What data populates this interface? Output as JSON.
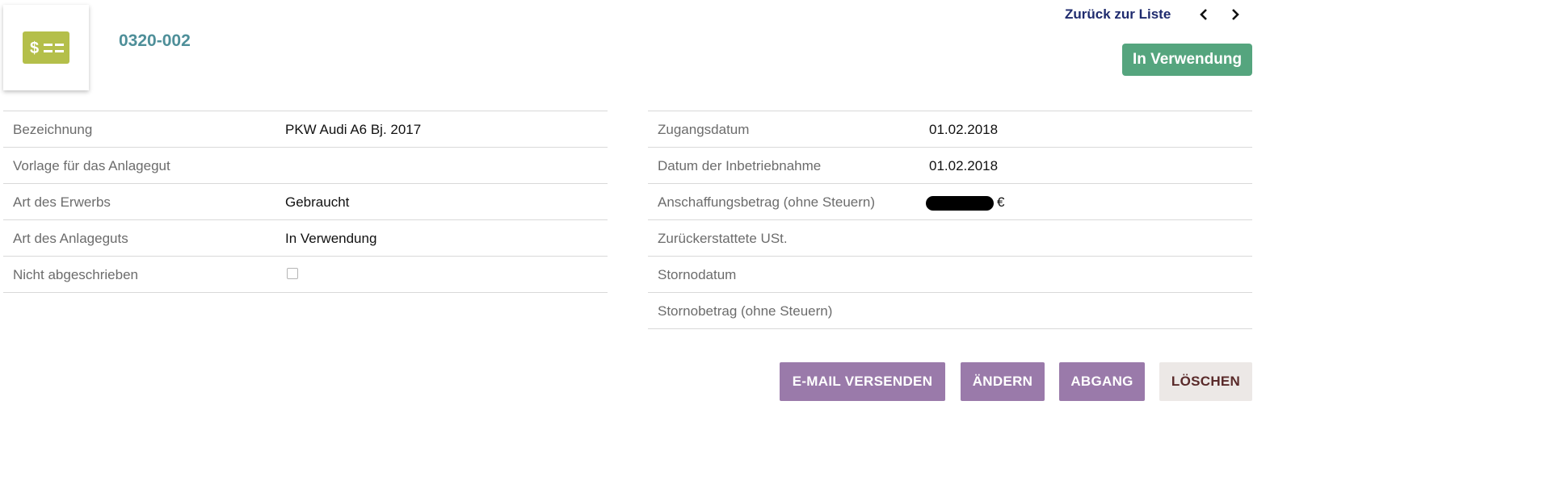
{
  "header": {
    "asset_id": "0320-002",
    "back_link": "Zurück zur Liste",
    "status": "In Verwendung",
    "logo_icon": "money-bill-icon",
    "logo_color": "#b4bf4a"
  },
  "left_table": [
    {
      "label": "Bezeichnung",
      "value": "PKW Audi A6 Bj. 2017"
    },
    {
      "label": "Vorlage für das Anlagegut",
      "value": ""
    },
    {
      "label": "Art des Erwerbs",
      "value": "Gebraucht"
    },
    {
      "label": "Art des Anlageguts",
      "value": "In Verwendung"
    },
    {
      "label": "Nicht abgeschrieben",
      "value": ""
    }
  ],
  "right_table": [
    {
      "label": "Zugangsdatum",
      "value": "01.02.2018"
    },
    {
      "label": "Datum der Inbetriebnahme",
      "value": "01.02.2018"
    },
    {
      "label": "Anschaffungsbetrag (ohne Steuern)",
      "value": "€"
    },
    {
      "label": "Zurückerstattete USt.",
      "value": ""
    },
    {
      "label": "Stornodatum",
      "value": ""
    },
    {
      "label": "Stornobetrag (ohne Steuern)",
      "value": ""
    }
  ],
  "buttons": {
    "email": "E-MAIL VERSENDEN",
    "edit": "ÄNDERN",
    "dispose": "ABGANG",
    "delete": "LÖSCHEN"
  },
  "colors": {
    "accent_text": "#4e8f99",
    "status_green": "#55a57e",
    "button_purple": "#9a7aaa"
  }
}
